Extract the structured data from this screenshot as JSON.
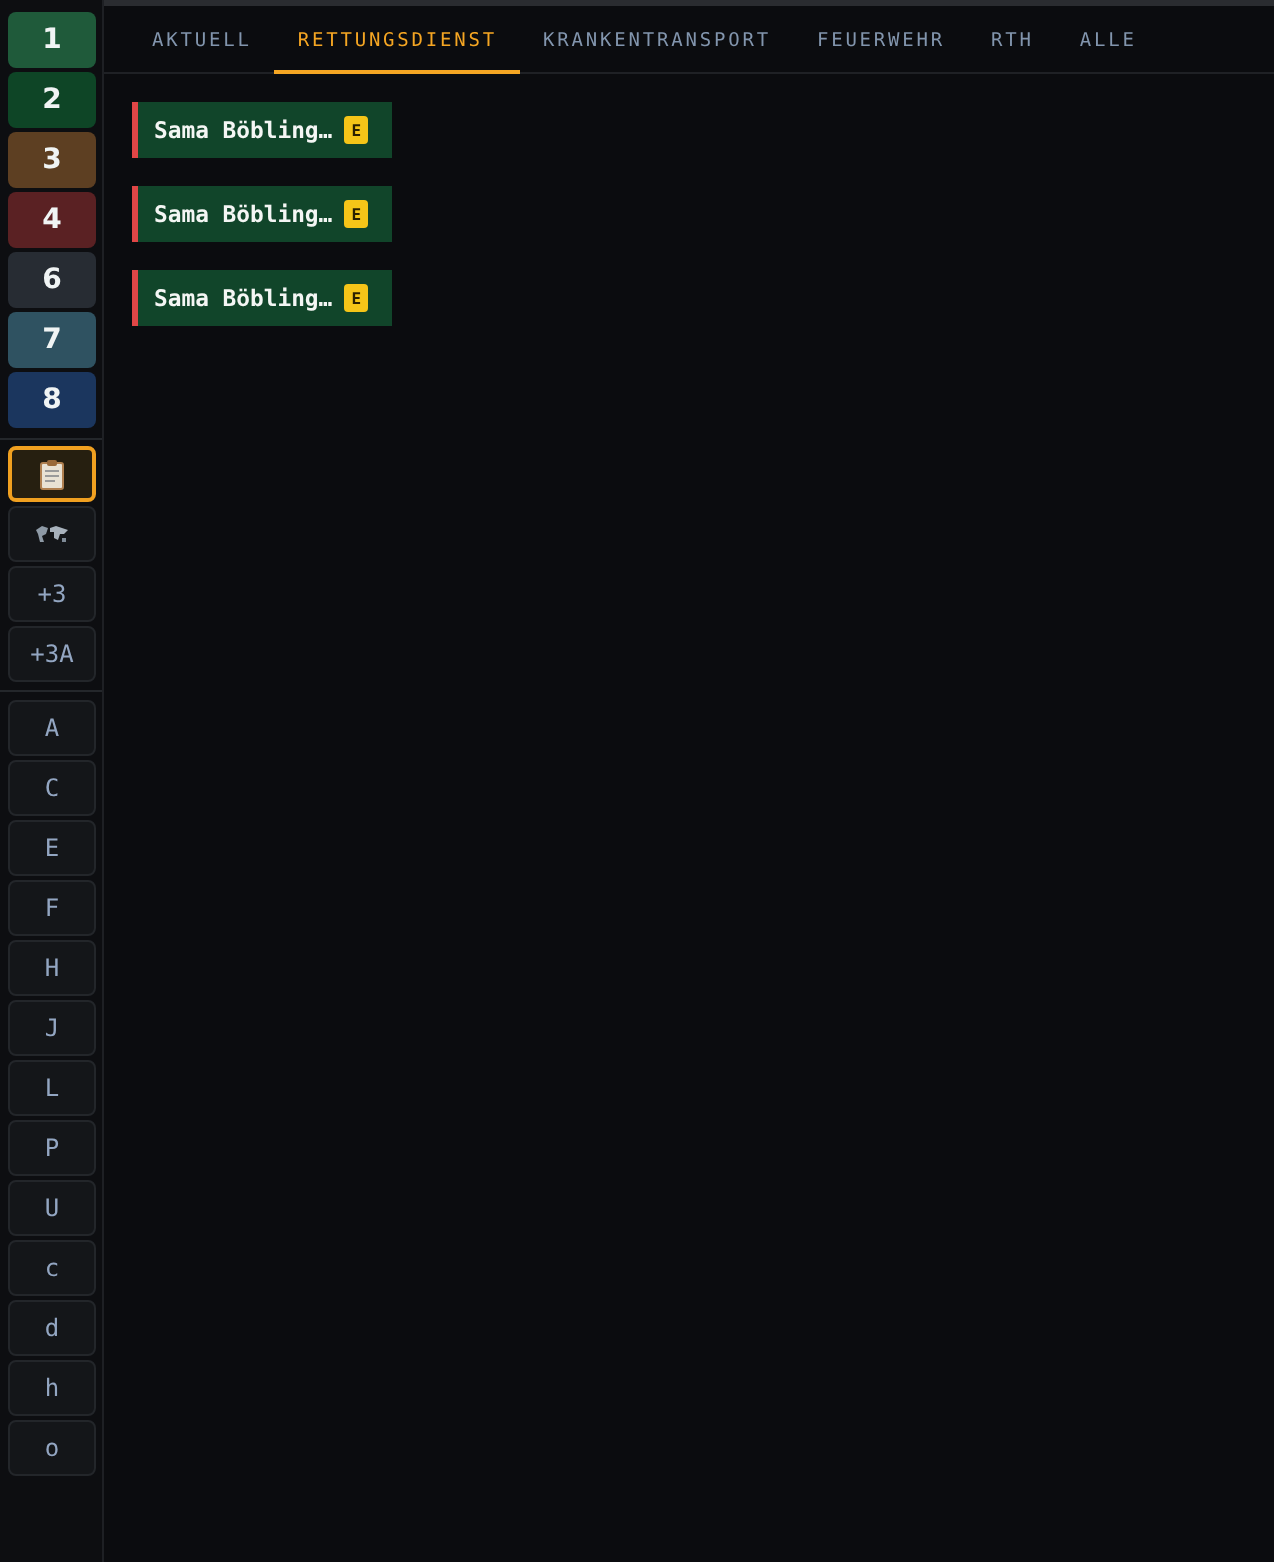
{
  "sidebar": {
    "level_buttons": [
      {
        "label": "1",
        "color": "#1f5a3a"
      },
      {
        "label": "2",
        "color": "#0e4526"
      },
      {
        "label": "3",
        "color": "#5d3f22"
      },
      {
        "label": "4",
        "color": "#5a2123"
      },
      {
        "label": "6",
        "color": "#272c33"
      },
      {
        "label": "7",
        "color": "#2f5261"
      },
      {
        "label": "8",
        "color": "#1b365e"
      }
    ],
    "tool_buttons": [
      {
        "kind": "clipboard",
        "selected": true
      },
      {
        "kind": "map",
        "selected": false
      },
      {
        "kind": "text",
        "label": "+3",
        "selected": false
      },
      {
        "kind": "text",
        "label": "+3A",
        "selected": false
      }
    ],
    "letter_buttons": [
      {
        "label": "A"
      },
      {
        "label": "C"
      },
      {
        "label": "E"
      },
      {
        "label": "F"
      },
      {
        "label": "H"
      },
      {
        "label": "J"
      },
      {
        "label": "L"
      },
      {
        "label": "P"
      },
      {
        "label": "U"
      },
      {
        "label": "c"
      },
      {
        "label": "d"
      },
      {
        "label": "h"
      },
      {
        "label": "o"
      }
    ]
  },
  "tabs": [
    {
      "label": "AKTUELL",
      "selected": false
    },
    {
      "label": "RETTUNGSDIENST",
      "selected": true
    },
    {
      "label": "KRANKENTRANSPORT",
      "selected": false
    },
    {
      "label": "FEUERWEHR",
      "selected": false
    },
    {
      "label": "RTH",
      "selected": false
    },
    {
      "label": "ALLE",
      "selected": false
    }
  ],
  "cards": [
    {
      "title": "Sama Böbling…",
      "badge": "E"
    },
    {
      "title": "Sama Böbling…",
      "badge": "E"
    },
    {
      "title": "Sama Böbling…",
      "badge": "E"
    }
  ]
}
